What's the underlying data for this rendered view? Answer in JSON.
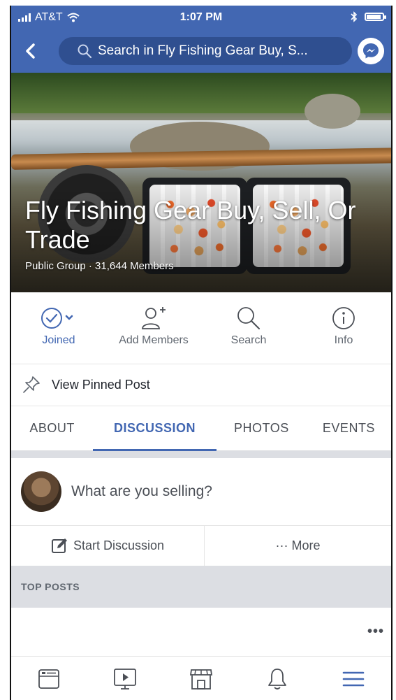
{
  "status_bar": {
    "carrier": "AT&T",
    "time": "1:07 PM",
    "bluetooth_icon": "bluetooth-icon",
    "battery_level": 0.9
  },
  "nav": {
    "search_text": "Search in Fly Fishing Gear Buy, S...",
    "back_icon": "back-arrow-icon",
    "messenger_icon": "messenger-icon"
  },
  "group": {
    "name": "Fly Fishing Gear Buy, Sell, Or Trade",
    "meta": "Public Group · 31,644 Members"
  },
  "actions": [
    {
      "label": "Joined",
      "icon": "checkmark-circle-icon"
    },
    {
      "label": "Add Members",
      "icon": "add-person-icon"
    },
    {
      "label": "Search",
      "icon": "search-icon"
    },
    {
      "label": "Info",
      "icon": "info-icon"
    }
  ],
  "pinned": {
    "label": "View Pinned Post",
    "icon": "pin-icon"
  },
  "tabs": [
    "ABOUT",
    "DISCUSSION",
    "PHOTOS",
    "EVENTS"
  ],
  "composer": {
    "placeholder": "What are you selling?"
  },
  "subactions": {
    "start": "Start Discussion",
    "more": "··· More"
  },
  "section": {
    "top_posts": "TOP POSTS"
  },
  "post": {
    "more": "•••"
  },
  "bottom_nav": [
    "news-feed-icon",
    "watch-icon",
    "marketplace-icon",
    "notifications-bell-icon",
    "menu-icon"
  ],
  "colors": {
    "brand": "#4267b2",
    "search_bg": "#2f4f90",
    "divider": "#dcdee3"
  }
}
